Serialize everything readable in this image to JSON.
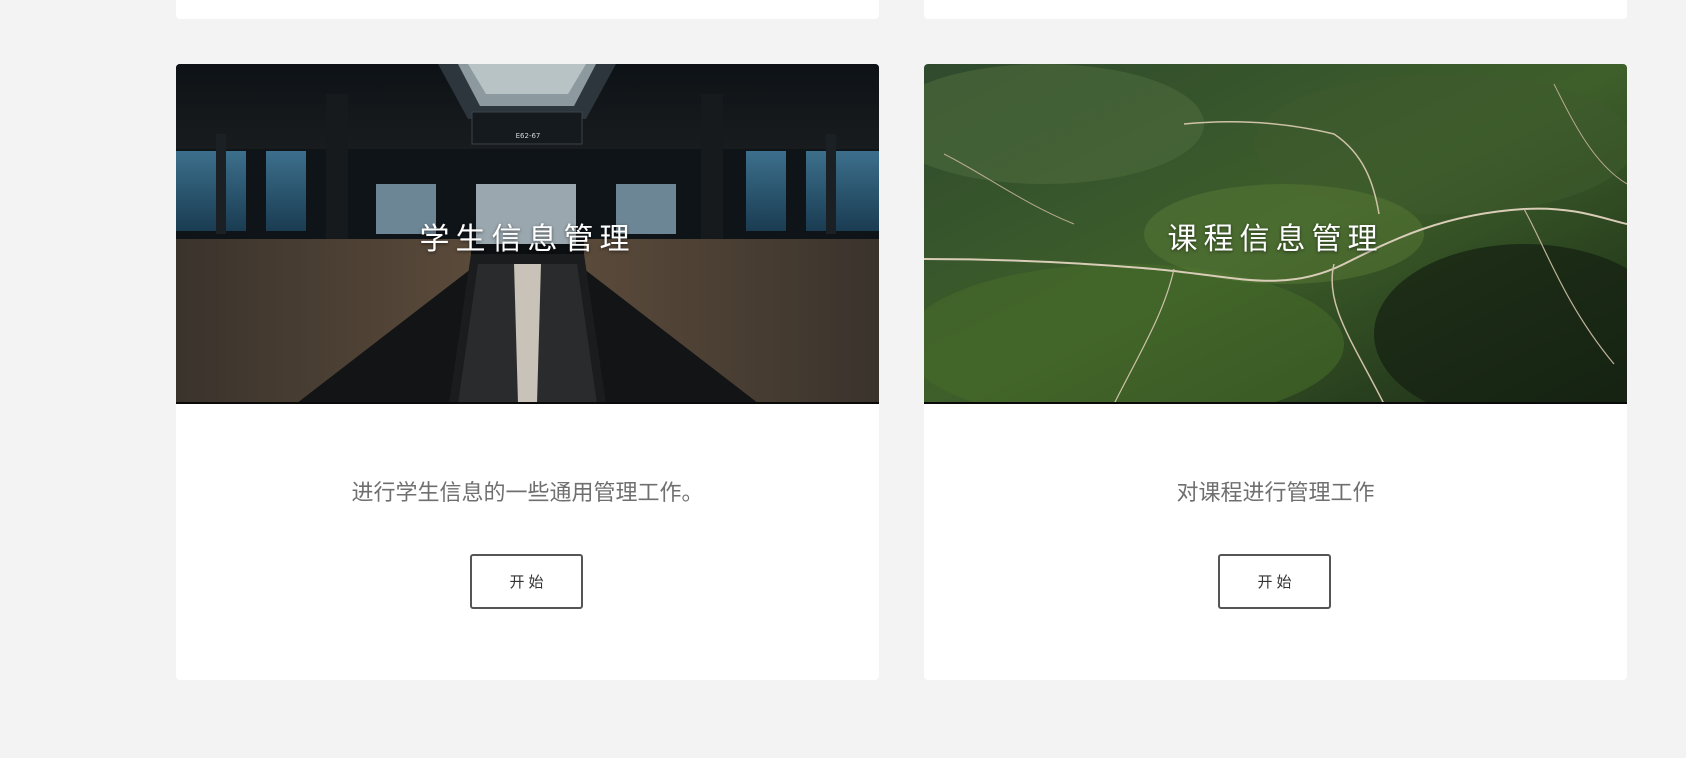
{
  "cards": [
    {
      "title": "学生信息管理",
      "description": "进行学生信息的一些通用管理工作。",
      "button_label": "开始",
      "sign_text": "E62-67"
    },
    {
      "title": "课程信息管理",
      "description": "对课程进行管理工作",
      "button_label": "开始"
    }
  ],
  "colors": {
    "page_background": "#f3f3f3",
    "card_background": "#ffffff",
    "description_text": "#6f6f6f",
    "button_border": "#555555"
  }
}
